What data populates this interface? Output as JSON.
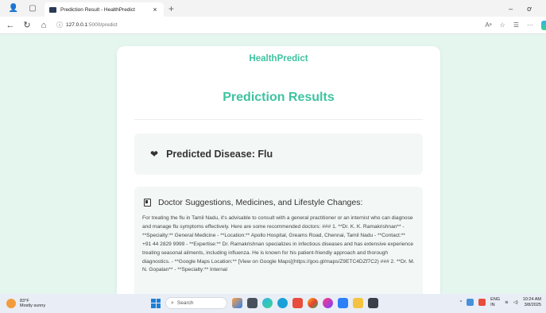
{
  "browser": {
    "tab_title": "Prediction Result - HealthPredict",
    "tab_close": "×",
    "new_tab": "+",
    "url_host": "127.0.0.1",
    "url_path": ":5000/predict",
    "window_minimize": "–",
    "window_restore": "ơ"
  },
  "page": {
    "brand": "HealthPredict",
    "heading": "Prediction Results",
    "disease_label": "Predicted Disease: Flu",
    "suggestions_heading": "Doctor Suggestions, Medicines, and Lifestyle Changes:",
    "suggestions_text": "For treating the flu in Tamil Nadu, it's advisable to consult with a general practitioner or an internist who can diagnose and manage flu symptoms effectively. Here are some recommended doctors: ### 1. **Dr. K. K. Ramakrishnan** - **Specialty:** General Medicine - **Location:** Apollo Hospital, Greams Road, Chennai, Tamil Nadu - **Contact:** +91 44 2829 9999 - **Expertise:** Dr. Ramakrishnan specializes in infectious diseases and has extensive experience treating seasonal ailments, including influenza. He is known for his patient-friendly approach and thorough diagnostics. - **Google Maps Location:** [View on Google Maps](https://goo.gl/maps/Z9ETC4DZf7C2) ### 2. **Dr. M. N. Gopalan** - **Specialty:** Internal"
  },
  "taskbar": {
    "temperature": "83°F",
    "weather": "Mostly sunny",
    "search_placeholder": "Search",
    "lang_top": "ENG",
    "lang_bottom": "IN",
    "time": "10:24 AM",
    "date": "3/8/2025"
  }
}
